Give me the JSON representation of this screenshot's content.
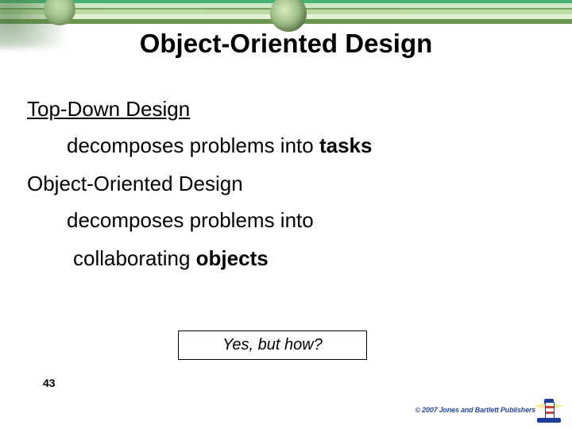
{
  "title": "Object-Oriented Design",
  "sections": {
    "topdown": {
      "heading": "Top-Down Design",
      "line": "decomposes problems into ",
      "strong": "tasks"
    },
    "ood": {
      "heading": "Object-Oriented Design",
      "line1": "decomposes problems into",
      "line2_pre": "collaborating ",
      "line2_strong": "objects"
    }
  },
  "callout": "Yes, but how?",
  "page_number": "43",
  "copyright": "© 2007 Jones and Bartlett Publishers"
}
